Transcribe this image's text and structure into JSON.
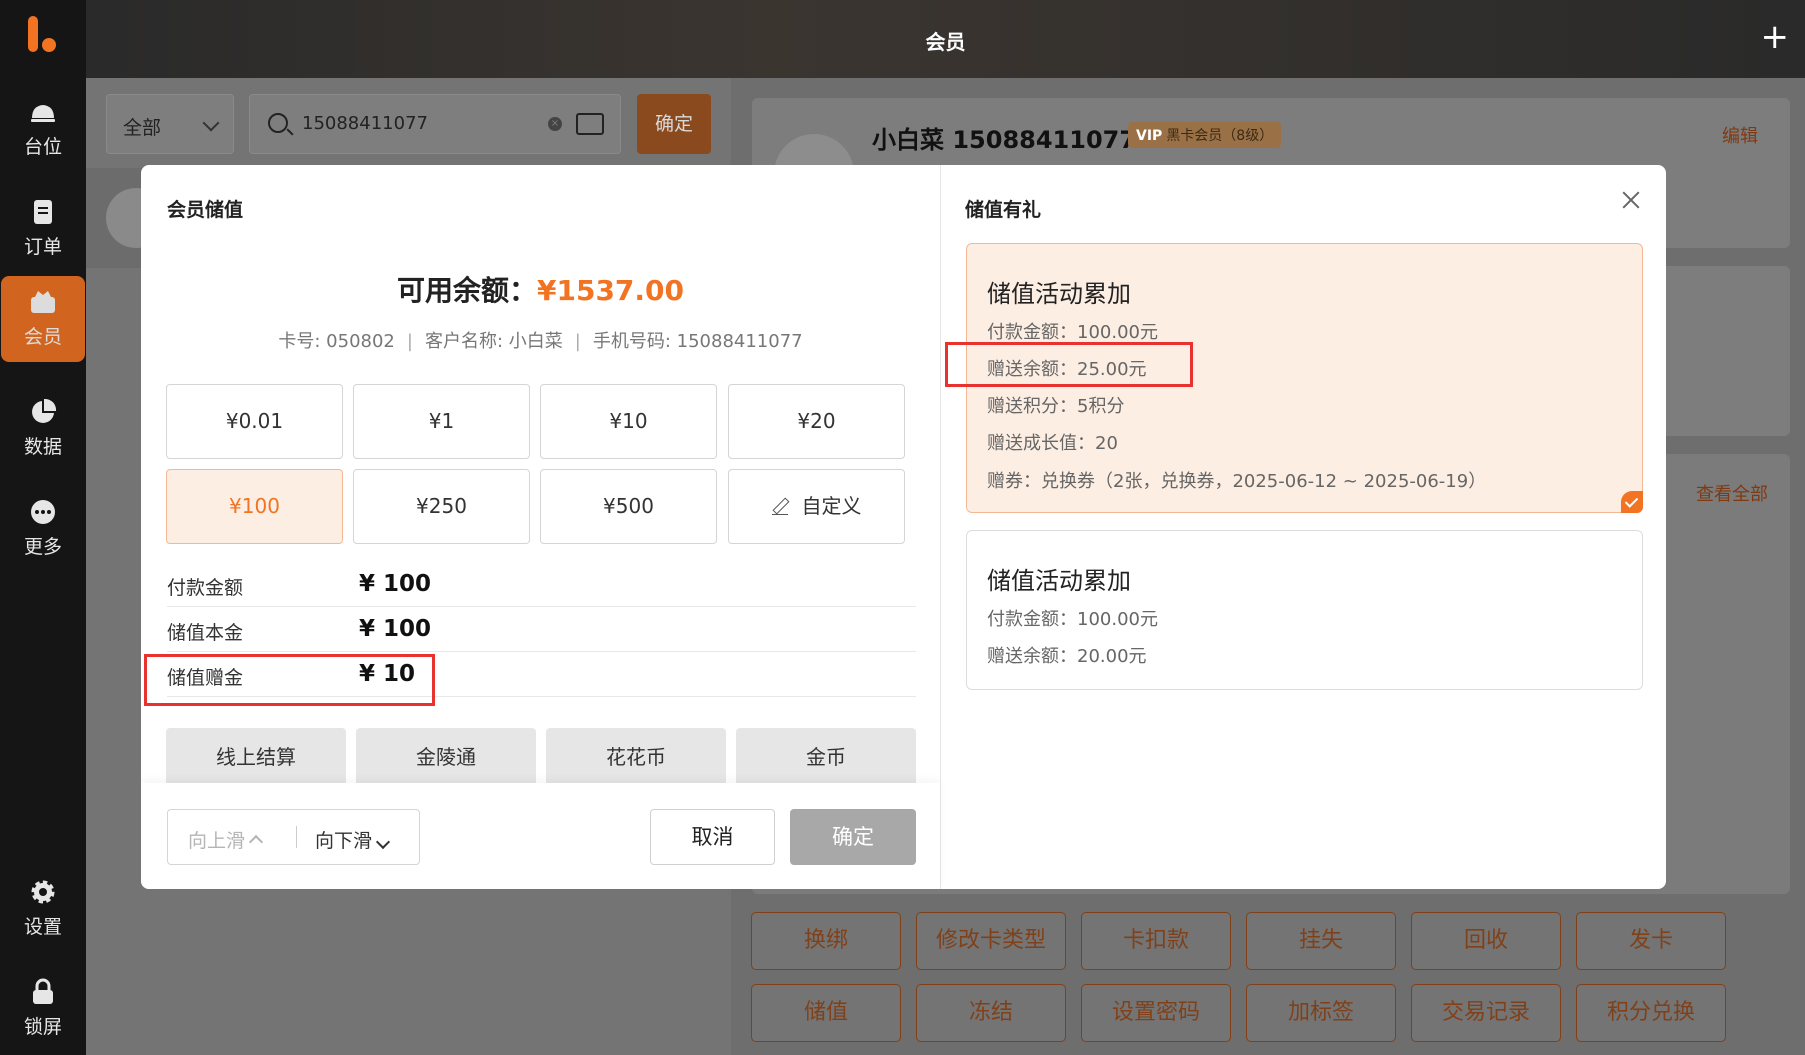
{
  "header": {
    "title": "会员"
  },
  "sidebar": {
    "items": [
      {
        "label": "台位",
        "icon": "table-bell-icon"
      },
      {
        "label": "订单",
        "icon": "order-icon"
      },
      {
        "label": "会员",
        "icon": "member-icon"
      },
      {
        "label": "数据",
        "icon": "pie-chart-icon"
      },
      {
        "label": "更多",
        "icon": "more-icon"
      },
      {
        "label": "设置",
        "icon": "gear-icon"
      },
      {
        "label": "锁屏",
        "icon": "lock-icon"
      }
    ]
  },
  "colors": {
    "accent": "#f27423",
    "highlight": "#e8322f"
  },
  "search": {
    "filter": "全部",
    "value": "15088411077",
    "confirm": "确定"
  },
  "member": {
    "name": "小白菜 15088411077",
    "vip_badge": "VIP",
    "level": "黑卡会员（8级）",
    "edit": "编辑",
    "view_all": "查看全部"
  },
  "actions": [
    "换绑",
    "修改卡类型",
    "卡扣款",
    "挂失",
    "回收",
    "发卡",
    "储值",
    "冻结",
    "设置密码",
    "加标签",
    "交易记录",
    "积分兑换"
  ],
  "modal": {
    "left_title": "会员储值",
    "right_title": "储值有礼",
    "balance_label": "可用余额：",
    "balance_value": "¥1537.00",
    "card_no": "卡号: 050802",
    "customer": "客户名称: 小白菜",
    "phone": "手机号码: 15088411077",
    "amounts": [
      "¥0.01",
      "¥1",
      "¥10",
      "¥20",
      "¥100",
      "¥250",
      "¥500",
      "自定义"
    ],
    "selected_amount": "¥100",
    "summary": [
      {
        "label": "付款金额",
        "value": "¥ 100"
      },
      {
        "label": "储值本金",
        "value": "¥ 100"
      },
      {
        "label": "储值赠金",
        "value": "¥ 10"
      }
    ],
    "payments": [
      "线上结算",
      "金陵通",
      "花花币",
      "金币"
    ],
    "scroll_up": "向上滑",
    "scroll_down": "向下滑",
    "cancel": "取消",
    "confirm": "确定",
    "promos": [
      {
        "title": "储值活动累加",
        "lines": [
          "付款金额：100.00元",
          "赠送余额：25.00元",
          "赠送积分：5积分",
          "赠送成长值：20",
          "赠券：兑换券（2张，兑换券，2025-06-12 ~ 2025-06-19）"
        ],
        "selected": true
      },
      {
        "title": "储值活动累加",
        "lines": [
          "付款金额：100.00元",
          "赠送余额：20.00元"
        ],
        "selected": false
      }
    ]
  }
}
